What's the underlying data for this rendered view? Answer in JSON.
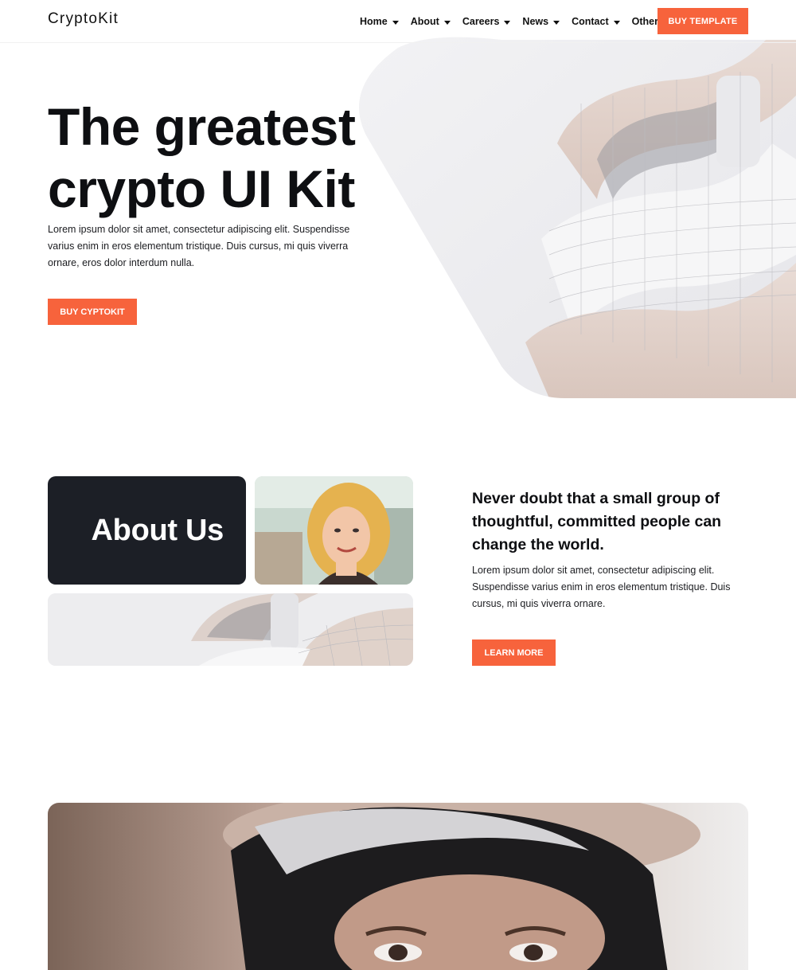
{
  "header": {
    "logo": "CryptoKit",
    "nav": [
      {
        "label": "Home"
      },
      {
        "label": "About"
      },
      {
        "label": "Careers"
      },
      {
        "label": "News"
      },
      {
        "label": "Contact"
      },
      {
        "label": "Other"
      }
    ],
    "cta_label": "BUY TEMPLATE"
  },
  "hero": {
    "title_line1": "The greatest",
    "title_line2": "crypto UI Kit",
    "text": "Lorem ipsum dolor sit amet, consectetur adipiscing elit. Suspendisse varius enim in eros elementum tristique. Duis cursus, mi quis viverra ornare, eros dolor interdum nulla.",
    "cta_label": "BUY CYPTOKIT"
  },
  "about": {
    "card_title": "About Us",
    "quote": "Never doubt that a small group of thoughtful, committed people can change the world.",
    "text": "Lorem ipsum dolor sit amet, consectetur adipiscing elit. Suspendisse varius enim in eros elementum tristique. Duis cursus, mi quis viverra ornare.",
    "cta_label": "LEARN MORE"
  },
  "colors": {
    "accent": "#f7633c",
    "dark_card": "#1c1f26",
    "text": "#111318"
  }
}
